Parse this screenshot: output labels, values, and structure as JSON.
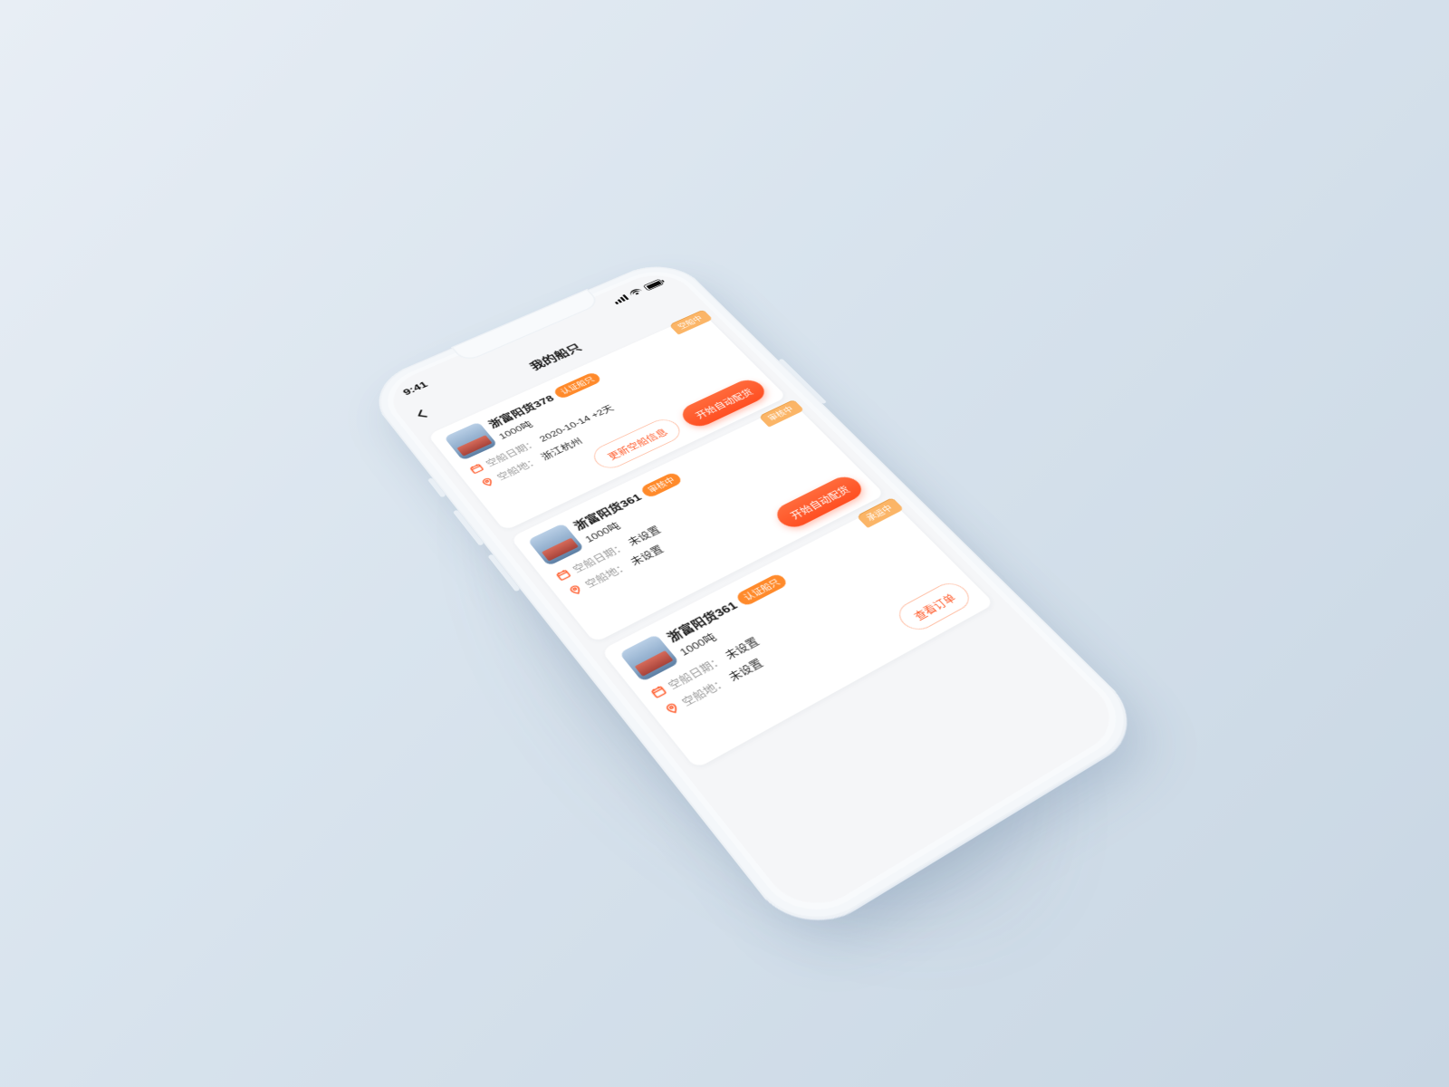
{
  "statusbar": {
    "time": "9:41"
  },
  "nav": {
    "title": "我的船只"
  },
  "labels": {
    "empty_date": "空船日期：",
    "empty_loc": "空船地："
  },
  "ships": [
    {
      "ribbon": "空船中",
      "name": "浙富阳货378",
      "badge": "认证船只",
      "tonnage": "1000吨",
      "empty_date": "2020-10-14 +2天",
      "empty_loc": "浙江杭州",
      "actions": {
        "secondary": "更新空船信息",
        "primary": "开始自动配货",
        "primary_style": "solid"
      }
    },
    {
      "ribbon": "审核中",
      "name": "浙富阳货361",
      "badge": "审核中",
      "tonnage": "1000吨",
      "empty_date": "未设置",
      "empty_loc": "未设置",
      "actions": {
        "secondary": null,
        "primary": "开始自动配货",
        "primary_style": "solid"
      }
    },
    {
      "ribbon": "承运中",
      "name": "浙富阳货361",
      "badge": "认证船只",
      "tonnage": "1000吨",
      "empty_date": "未设置",
      "empty_loc": "未设置",
      "actions": {
        "secondary": null,
        "primary": "查看订单",
        "primary_style": "outline"
      }
    }
  ]
}
